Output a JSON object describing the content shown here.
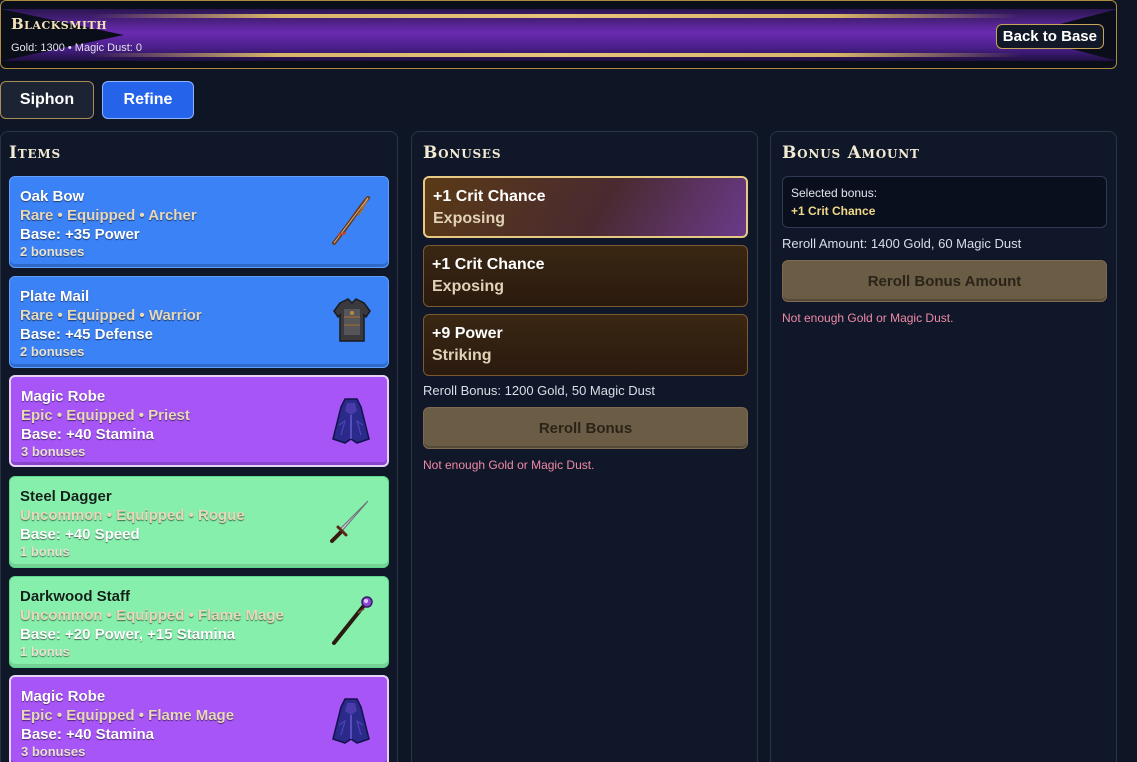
{
  "header": {
    "title": "Blacksmith",
    "resources": "Gold: 1300 • Magic Dust: 0",
    "back_label": "Back to Base"
  },
  "tabs": [
    {
      "label": "Siphon",
      "active": false
    },
    {
      "label": "Refine",
      "active": true
    }
  ],
  "items_panel": {
    "title": "Items",
    "items": [
      {
        "name": "Oak Bow",
        "meta": "Rare • Equipped • Archer",
        "base": "Base: +35 Power",
        "bonuses": "2 bonuses",
        "rarity": "rare",
        "icon": "bow-icon"
      },
      {
        "name": "Plate Mail",
        "meta": "Rare • Equipped • Warrior",
        "base": "Base: +45 Defense",
        "bonuses": "2 bonuses",
        "rarity": "rare",
        "icon": "armor-icon"
      },
      {
        "name": "Magic Robe",
        "meta": "Epic • Equipped • Priest",
        "base": "Base: +40 Stamina",
        "bonuses": "3 bonuses",
        "rarity": "epic",
        "icon": "robe-icon"
      },
      {
        "name": "Steel Dagger",
        "meta": "Uncommon • Equipped • Rogue",
        "base": "Base: +40 Speed",
        "bonuses": "1 bonus",
        "rarity": "uncommon",
        "icon": "dagger-icon"
      },
      {
        "name": "Darkwood Staff",
        "meta": "Uncommon • Equipped • Flame Mage",
        "base": "Base: +20 Power, +15 Stamina",
        "bonuses": "1 bonus",
        "rarity": "uncommon",
        "icon": "staff-icon"
      },
      {
        "name": "Magic Robe",
        "meta": "Epic • Equipped • Flame Mage",
        "base": "Base: +40 Stamina",
        "bonuses": "3 bonuses",
        "rarity": "epic",
        "icon": "robe-icon"
      }
    ]
  },
  "bonuses_panel": {
    "title": "Bonuses",
    "bonuses": [
      {
        "name": "+1 Crit Chance",
        "type": "Exposing",
        "selected": true
      },
      {
        "name": "+1 Crit Chance",
        "type": "Exposing",
        "selected": false
      },
      {
        "name": "+9 Power",
        "type": "Striking",
        "selected": false
      }
    ],
    "cost": "Reroll Bonus: 1200 Gold, 50 Magic Dust",
    "button_label": "Reroll Bonus",
    "warning": "Not enough Gold or Magic Dust."
  },
  "amount_panel": {
    "title": "Bonus Amount",
    "selected_label": "Selected bonus:",
    "selected_value": "+1 Crit Chance",
    "cost": "Reroll Amount: 1400 Gold, 60 Magic Dust",
    "button_label": "Reroll Bonus Amount",
    "warning": "Not enough Gold or Magic Dust."
  },
  "colors": {
    "rare": "#3b82f6",
    "epic": "#a855f7",
    "uncommon": "#86efac",
    "accent_gold": "#c9a35a",
    "warning": "#f08aa6"
  }
}
